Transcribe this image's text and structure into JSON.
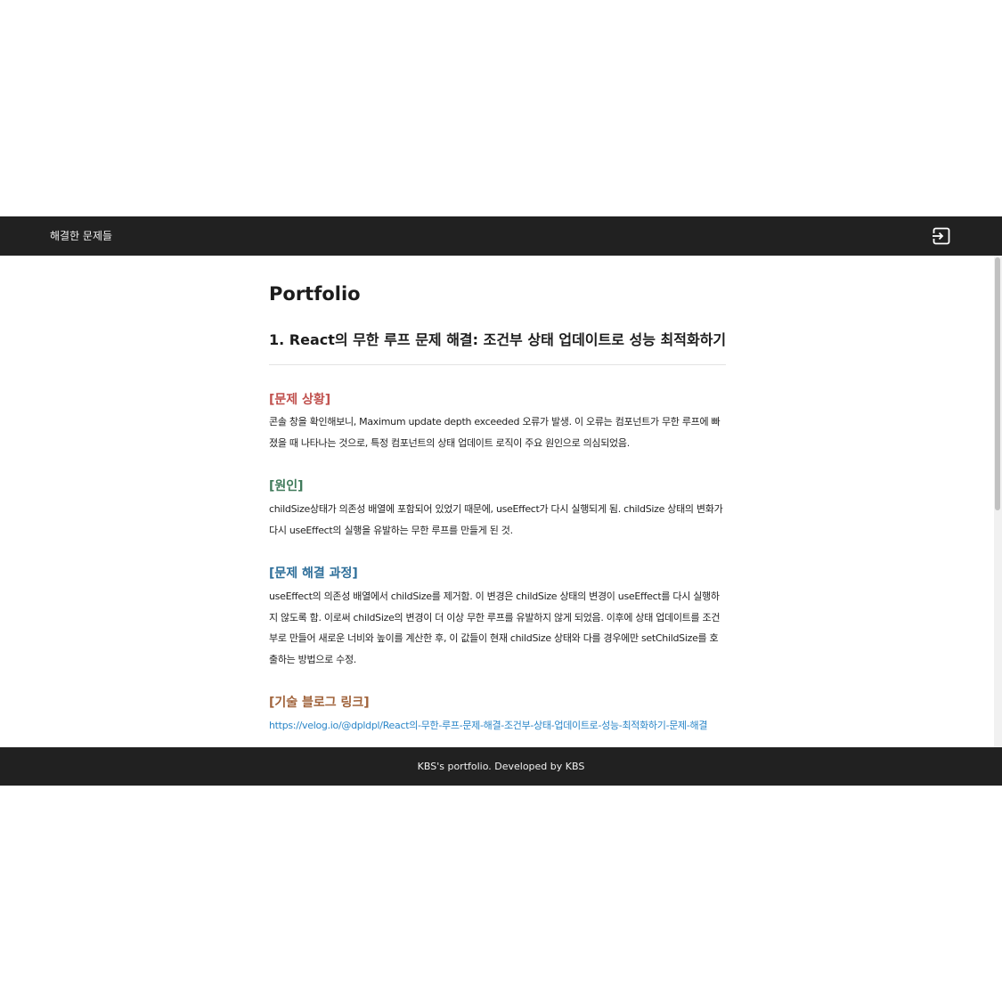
{
  "header": {
    "title": "해결한 문제들",
    "logout_icon": "logout-icon"
  },
  "article": {
    "page_title": "Portfolio",
    "problem_title": "1. React의 무한 루프 문제 해결: 조건부 상태 업데이트로 성능 최적화하기",
    "sections": [
      {
        "heading": "[문제 상황]",
        "color": "#c0504d",
        "body": "콘솔 창을 확인해보니, Maximum update depth exceeded 오류가 발생. 이 오류는 컴포넌트가 무한 루프에 빠졌을 때 나타나는 것으로, 특정 컴포넌트의 상태 업데이트 로직이 주요 원인으로 의심되었음."
      },
      {
        "heading": "[원인]",
        "color": "#3f7a5a",
        "body": "childSize상태가 의존성 배열에 포함되어 있었기 때문에, useEffect가 다시 실행되게 됨. childSize 상태의 변화가 다시 useEffect의 실행을 유발하는 무한 루프를 만들게 된 것."
      },
      {
        "heading": "[문제 해결 과정]",
        "color": "#2f6f9a",
        "body": "useEffect의 의존성 배열에서 childSize를 제거함. 이 변경은 childSize 상태의 변경이 useEffect를 다시 실행하지 않도록 함. 이로써 childSize의 변경이 더 이상 무한 루프를 유발하지 않게 되었음. 이후에 상태 업데이트를 조건부로 만들어 새로운 너비와 높이를 계산한 후, 이 값들이 현재 childSize 상태와 다를 경우에만 setChildSize를 호출하는 방법으로 수정."
      },
      {
        "heading": "[기술 블로그 링크]",
        "color": "#a0623a",
        "link": "https://velog.io/@dpldpl/React의-무한-루프-문제-해결-조건부-상태-업데이트로-성능-최적화하기-문제-해결"
      }
    ]
  },
  "footer": {
    "text": "KBS's portfolio. Developed by KBS"
  }
}
